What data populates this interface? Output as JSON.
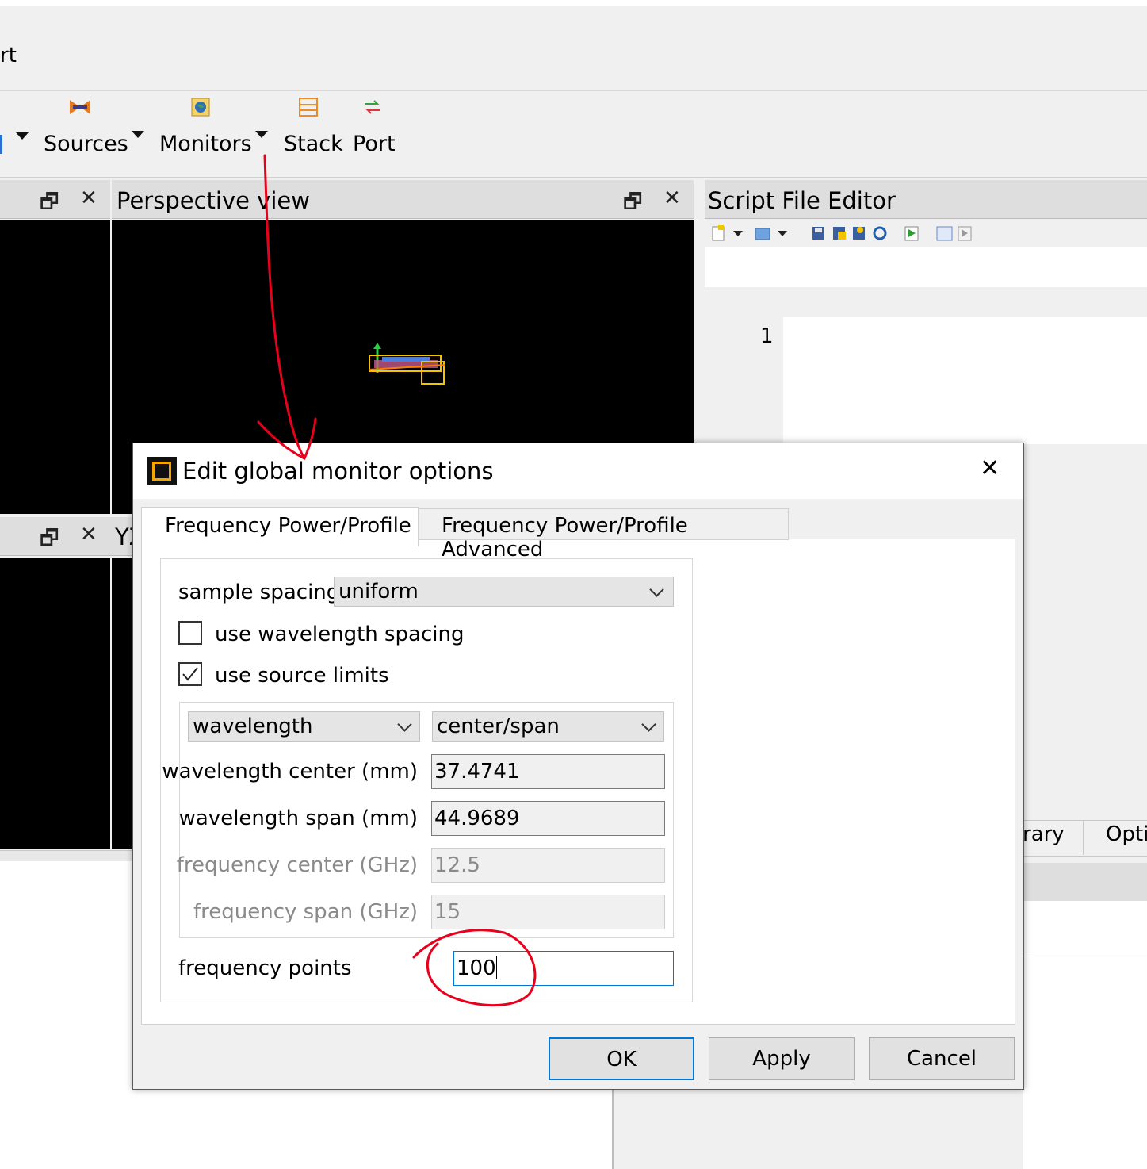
{
  "menubar": {
    "fragment": "rt"
  },
  "toolbar": {
    "items": [
      {
        "label": "Sources",
        "icon": "sources-icon"
      },
      {
        "label": "Monitors",
        "icon": "monitors-icon"
      },
      {
        "label": "Stack",
        "icon": "stack-icon"
      },
      {
        "label": "Port",
        "icon": "port-icon"
      }
    ]
  },
  "panels": {
    "perspective": {
      "title": "Perspective view"
    },
    "yz": {
      "title": "YZ"
    },
    "script_editor": {
      "title": "Script File Editor",
      "line_number": "1"
    }
  },
  "right_dock": {
    "tab1": "rary",
    "tab2": "Opti"
  },
  "dialog": {
    "title": "Edit global monitor options",
    "tabs": [
      "Frequency Power/Profile",
      "Frequency Power/Profile Advanced"
    ],
    "sample_spacing": {
      "label": "sample spacing",
      "value": "uniform"
    },
    "use_wavelength_spacing": {
      "label": "use wavelength spacing",
      "checked": false
    },
    "use_source_limits": {
      "label": "use source limits",
      "checked": true
    },
    "range_type": "wavelength",
    "range_mode": "center/span",
    "fields": [
      {
        "label": "wavelength center (mm)",
        "value": "37.4741",
        "enabled": true
      },
      {
        "label": "wavelength span (mm)",
        "value": "44.9689",
        "enabled": true
      },
      {
        "label": "frequency center (GHz)",
        "value": "12.5",
        "enabled": false
      },
      {
        "label": "frequency span (GHz)",
        "value": "15",
        "enabled": false
      }
    ],
    "frequency_points": {
      "label": "frequency points",
      "value": "100"
    },
    "buttons": {
      "ok": "OK",
      "apply": "Apply",
      "cancel": "Cancel"
    }
  },
  "colors": {
    "accent": "#0078d7",
    "annotation": "#e8001c",
    "icon_orange": "#f5a500"
  }
}
